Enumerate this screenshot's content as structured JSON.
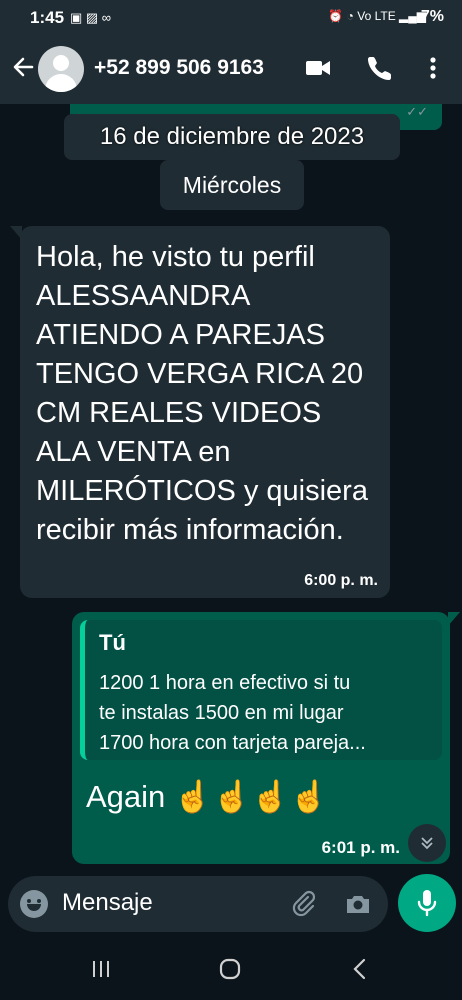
{
  "status_bar": {
    "time": "1:45",
    "left_icons": "▣ ▨ ∞",
    "right_icons": "⏰ ◔ Vo LTE ▂▄▆",
    "battery": "7%"
  },
  "header": {
    "contact": "+52 899 506 9163",
    "icons": [
      "back-arrow-icon",
      "avatar",
      "video-call-icon",
      "phone-icon",
      "more-icon"
    ]
  },
  "chat": {
    "date_chip": "16 de diciembre de 2023",
    "day_chip": "Miércoles",
    "incoming": {
      "text": "Hola, he visto tu perfil ALESSAANDRA ATIENDO A PAREJAS TENGO VERGA RICA 20 CM REALES VIDEOS ALA VENTA en MILERÓTICOS y quisiera recibir más información.",
      "time": "6:00 p. m."
    },
    "outgoing": {
      "quote_author": "Tú",
      "quote_line1": "1200 1 hora en efectivo si tu",
      "quote_line2": "te instalas 1500 en mi lugar",
      "quote_line3": "1700 hora con tarjeta   pareja...",
      "message": "Again ☝️☝️☝️☝️",
      "time": "6:01 p. m."
    }
  },
  "composer": {
    "placeholder": "Mensaje"
  },
  "colors": {
    "background": "#0b141a",
    "incoming_bubble": "#1f2c33",
    "outgoing_bubble": "#005c4b",
    "accent": "#00a884"
  }
}
